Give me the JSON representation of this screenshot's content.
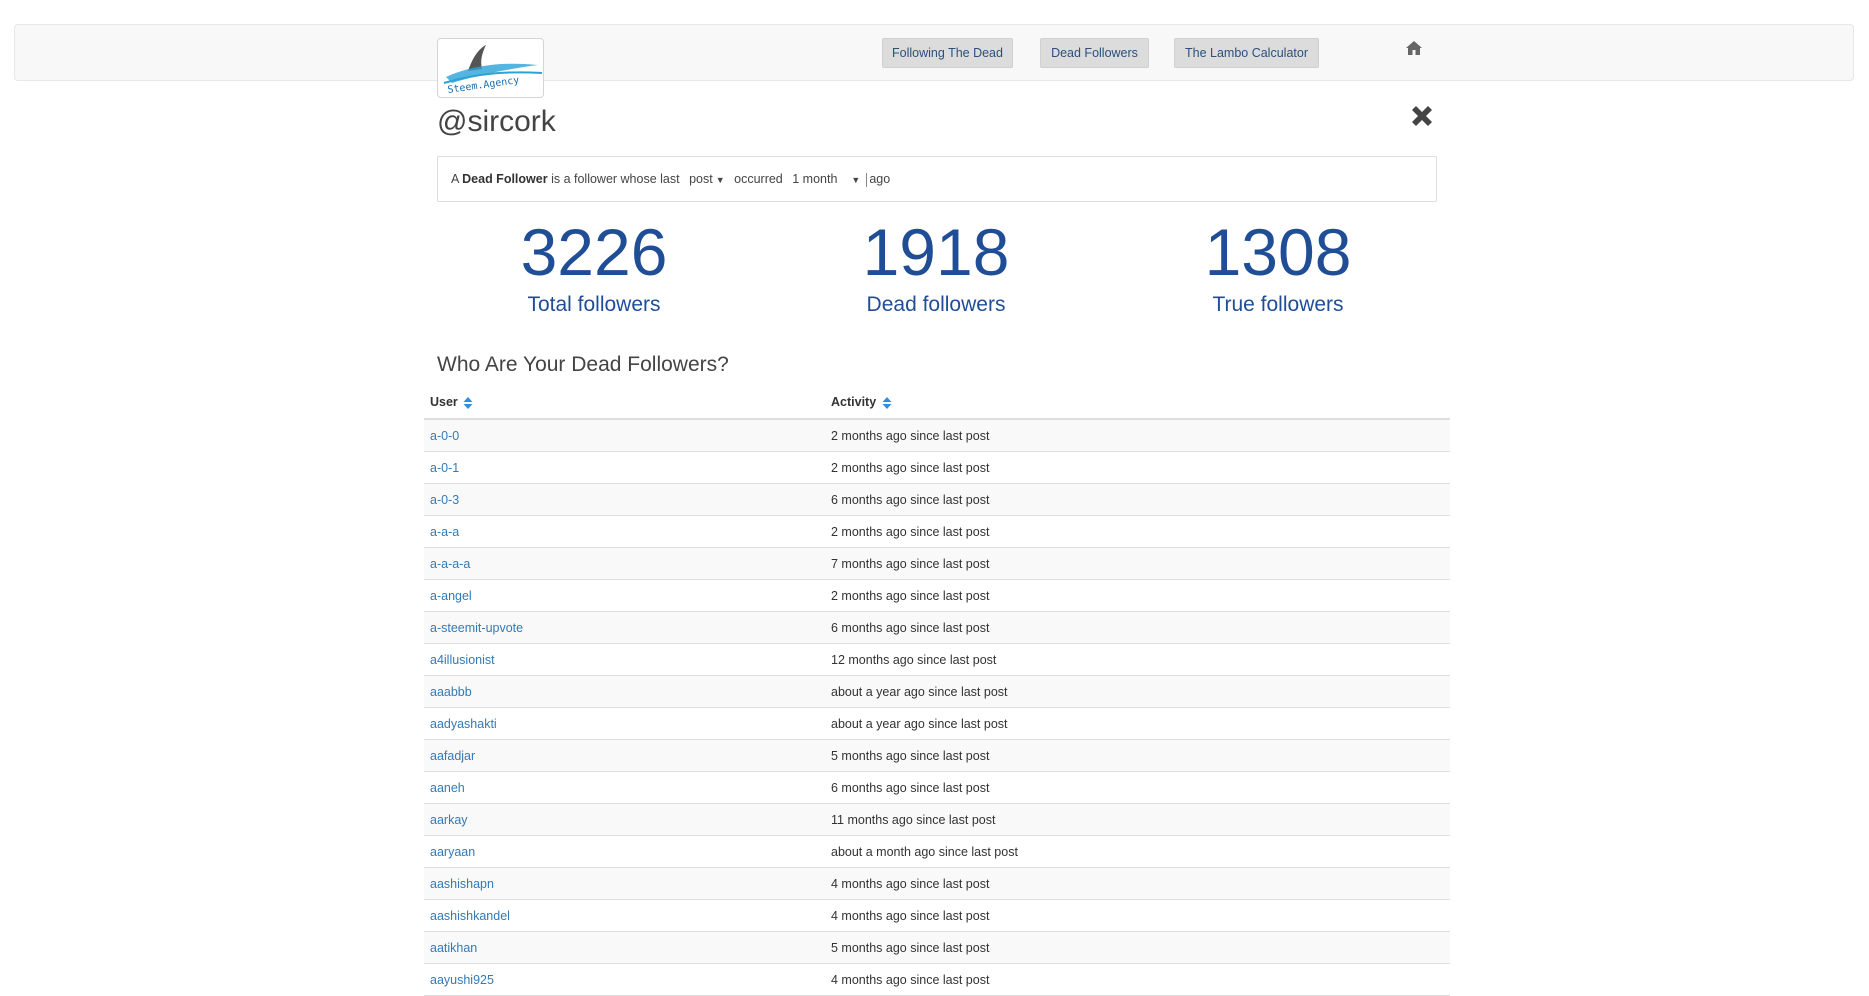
{
  "nav": {
    "logo_text": "Steem.Agency",
    "buttons": [
      "Following The Dead",
      "Dead Followers",
      "The Lambo Calculator"
    ]
  },
  "profile": {
    "username": "@sircork"
  },
  "definition": {
    "prefix": "A",
    "term": "Dead Follower",
    "middle": "is a follower whose last",
    "activity_type": "post",
    "occurred": "occurred",
    "period": "1 month",
    "suffix": "ago"
  },
  "stats": [
    {
      "value": "3226",
      "label": "Total followers"
    },
    {
      "value": "1918",
      "label": "Dead followers"
    },
    {
      "value": "1308",
      "label": "True followers"
    }
  ],
  "section_title": "Who Are Your Dead Followers?",
  "table": {
    "columns": [
      "User",
      "Activity"
    ],
    "rows": [
      {
        "user": "a-0-0",
        "activity": "2 months ago since last post"
      },
      {
        "user": "a-0-1",
        "activity": "2 months ago since last post"
      },
      {
        "user": "a-0-3",
        "activity": "6 months ago since last post"
      },
      {
        "user": "a-a-a",
        "activity": "2 months ago since last post"
      },
      {
        "user": "a-a-a-a",
        "activity": "7 months ago since last post"
      },
      {
        "user": "a-angel",
        "activity": "2 months ago since last post"
      },
      {
        "user": "a-steemit-upvote",
        "activity": "6 months ago since last post"
      },
      {
        "user": "a4illusionist",
        "activity": "12 months ago since last post"
      },
      {
        "user": "aaabbb",
        "activity": "about a year ago since last post"
      },
      {
        "user": "aadyashakti",
        "activity": "about a year ago since last post"
      },
      {
        "user": "aafadjar",
        "activity": "5 months ago since last post"
      },
      {
        "user": "aaneh",
        "activity": "6 months ago since last post"
      },
      {
        "user": "aarkay",
        "activity": "11 months ago since last post"
      },
      {
        "user": "aaryaan",
        "activity": "about a month ago since last post"
      },
      {
        "user": "aashishapn",
        "activity": "4 months ago since last post"
      },
      {
        "user": "aashishkandel",
        "activity": "4 months ago since last post"
      },
      {
        "user": "aatikhan",
        "activity": "5 months ago since last post"
      },
      {
        "user": "aayushi925",
        "activity": "4 months ago since last post"
      }
    ]
  },
  "colors": {
    "accent": "#1f4e96",
    "link": "#337ab7",
    "sort": "#2e8fe0"
  },
  "icons": [
    "home-icon",
    "close-icon",
    "sort-icon"
  ]
}
